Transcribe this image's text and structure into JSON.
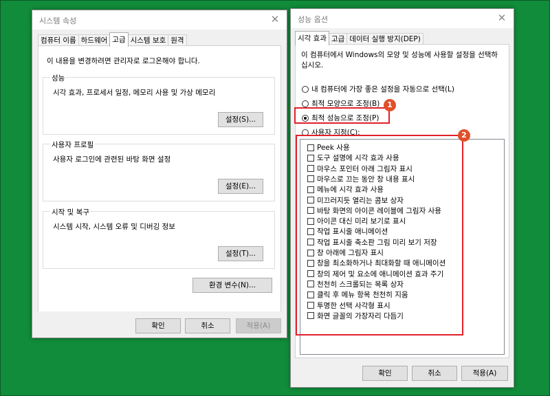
{
  "system_properties": {
    "title": "시스템 속성",
    "tabs": [
      "컴퓨터 이름",
      "하드웨어",
      "고급",
      "시스템 보호",
      "원격"
    ],
    "notice": "이 내용을 변경하려면 관리자로 로그온해야 합니다.",
    "groups": [
      {
        "title": "성능",
        "desc": "시각 효과, 프로세서 일정, 메모리 사용 및 가상 메모리",
        "button": "설정(S)..."
      },
      {
        "title": "사용자 프로필",
        "desc": "사용자 로그인에 관련된 바탕 화면 설정",
        "button": "설정(E)..."
      },
      {
        "title": "시작 및 복구",
        "desc": "시스템 시작, 시스템 오류 및 디버깅 정보",
        "button": "설정(T)..."
      }
    ],
    "env_button": "환경 변수(N)...",
    "ok": "확인",
    "cancel": "취소",
    "apply": "적용(A)"
  },
  "performance_options": {
    "title": "성능 옵션",
    "tabs": [
      "시각 효과",
      "고급",
      "데이터 실행 방지(DEP)"
    ],
    "description": "이 컴퓨터에서 Windows의 모양 및 성능에 사용할 설정을 선택하십시오.",
    "desc_line1": "이 컴퓨터에서 Windows의 모양 및 성능에 사용할 설정을 선택하",
    "desc_line2": "십시오.",
    "radios": [
      {
        "label": "내 컴퓨터에 가장 좋은 설정을 자동으로 선택(L)",
        "selected": false
      },
      {
        "label": "최적 모양으로 조정(B)",
        "selected": false
      },
      {
        "label": "최적 성능으로 조정(P)",
        "selected": true
      },
      {
        "label": "사용자 지정(C):",
        "selected": false
      }
    ],
    "effects": [
      "Peek 사용",
      "도구 설명에 시각 효과 사용",
      "마우스 포인터 아래 그림자 표시",
      "마우스로 끄는 동안 창 내용 표시",
      "메뉴에 시각 효과 사용",
      "미끄러지듯 열리는 콤보 상자",
      "바탕 화면의 아이콘 레이블에 그림자 사용",
      "아이콘 대신 미리 보기로 표시",
      "작업 표시줄 애니메이션",
      "작업 표시줄 축소판 그림 미리 보기 저장",
      "창 아래에 그림자 표시",
      "창을 최소화하거나 최대화할 때 애니메이션",
      "창의 제어 및 요소에 애니메이션 효과 주기",
      "천천히 스크롤되는 목록 상자",
      "클릭 후 메뉴 항목 천천히 지움",
      "투명한 선택 사각형 표시",
      "화면 글꼴의 가장자리 다듬기"
    ],
    "ok": "확인",
    "cancel": "취소",
    "apply": "적용(A)"
  },
  "annotations": {
    "badge1": "1",
    "badge2": "2",
    "color": "#e0202a"
  }
}
